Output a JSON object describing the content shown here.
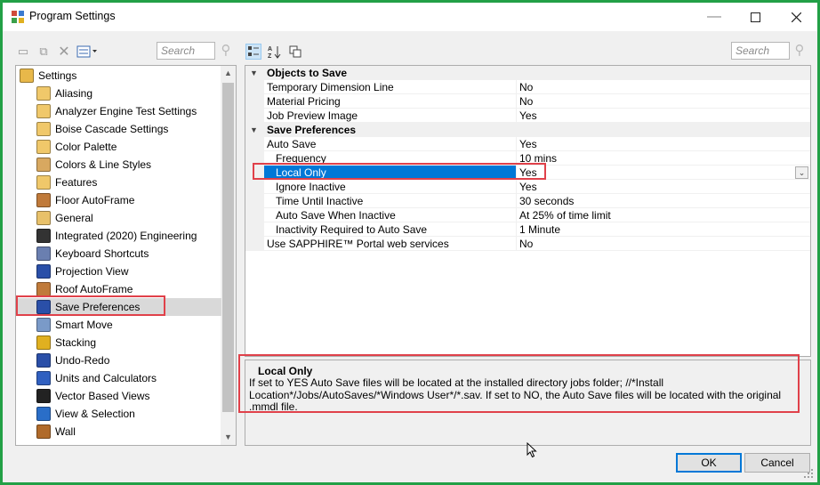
{
  "window": {
    "title": "Program Settings"
  },
  "left_panel": {
    "search_placeholder": "Search",
    "tree": [
      {
        "label": "Settings",
        "icon": "folder-icon",
        "color": "#e8b84a"
      },
      {
        "label": "Aliasing",
        "icon": "pencil-page-icon",
        "color": "#f0c86a"
      },
      {
        "label": "Analyzer Engine Test Settings",
        "icon": "pencil-page-icon",
        "color": "#f0c86a"
      },
      {
        "label": "Boise Cascade Settings",
        "icon": "pencil-page-icon",
        "color": "#f0c86a"
      },
      {
        "label": "Color Palette",
        "icon": "pencil-page-icon",
        "color": "#f0c86a"
      },
      {
        "label": "Colors & Line Styles",
        "icon": "palette-icon",
        "color": "#d8a860"
      },
      {
        "label": "Features",
        "icon": "pencil-page-icon",
        "color": "#f0c86a"
      },
      {
        "label": "Floor AutoFrame",
        "icon": "floor-frame-icon",
        "color": "#c07a3a"
      },
      {
        "label": "General",
        "icon": "general-icon",
        "color": "#e8c16a"
      },
      {
        "label": "Integrated (2020) Engineering",
        "icon": "gear-icon",
        "color": "#333333"
      },
      {
        "label": "Keyboard Shortcuts",
        "icon": "keyboard-icon",
        "color": "#6a7fb0"
      },
      {
        "label": "Projection View",
        "icon": "cube-icon",
        "color": "#2a4fa8"
      },
      {
        "label": "Roof AutoFrame",
        "icon": "roof-frame-icon",
        "color": "#c07a3a"
      },
      {
        "label": "Save Preferences",
        "icon": "floppy-disk-icon",
        "color": "#2a4fa8"
      },
      {
        "label": "Smart Move",
        "icon": "move-arrows-icon",
        "color": "#7a9ac8"
      },
      {
        "label": "Stacking",
        "icon": "stacking-icon",
        "color": "#e0b020"
      },
      {
        "label": "Undo-Redo",
        "icon": "undo-redo-icon",
        "color": "#2a4fa8"
      },
      {
        "label": "Units and Calculators",
        "icon": "calculator-icon",
        "color": "#3060c0"
      },
      {
        "label": "Vector Based Views",
        "icon": "vector-view-icon",
        "color": "#222222"
      },
      {
        "label": "View & Selection",
        "icon": "view-selection-icon",
        "color": "#2a6ec8"
      },
      {
        "label": "Wall",
        "icon": "wall-icon",
        "color": "#b06a2a"
      }
    ],
    "selected_index": 13
  },
  "right_panel": {
    "search_placeholder": "Search",
    "categories": [
      {
        "name": "Objects to Save",
        "rows": [
          {
            "name": "Temporary Dimension Line",
            "value": "No",
            "sub": false
          },
          {
            "name": "Material Pricing",
            "value": "No",
            "sub": false
          },
          {
            "name": "Job Preview Image",
            "value": "Yes",
            "sub": false
          }
        ]
      },
      {
        "name": "Save Preferences",
        "rows": [
          {
            "name": "Auto Save",
            "value": "Yes",
            "sub": false
          },
          {
            "name": "Frequency",
            "value": "10 mins",
            "sub": true
          },
          {
            "name": "Local Only",
            "value": "Yes",
            "sub": true,
            "selected": true
          },
          {
            "name": "Ignore Inactive",
            "value": "Yes",
            "sub": true
          },
          {
            "name": "Time Until Inactive",
            "value": "30 seconds",
            "sub": true
          },
          {
            "name": "Auto Save When Inactive",
            "value": "At 25% of time limit",
            "sub": true
          },
          {
            "name": "Inactivity Required to Auto Save",
            "value": "1 Minute",
            "sub": true
          },
          {
            "name": "Use SAPPHIRE™ Portal web services",
            "value": "No",
            "sub": false
          }
        ]
      }
    ],
    "help": {
      "title": "Local Only",
      "text": "If set to YES Auto Save files will be located at the installed directory jobs folder; //*Install Location*/Jobs/AutoSaves/*Windows User*/*.sav. If set to NO, the Auto Save files will be located with the original .mmdl file."
    }
  },
  "buttons": {
    "ok": "OK",
    "cancel": "Cancel"
  },
  "colors": {
    "selection": "#0078d7",
    "highlight_box": "#e0414a",
    "window_border": "#22a046"
  }
}
